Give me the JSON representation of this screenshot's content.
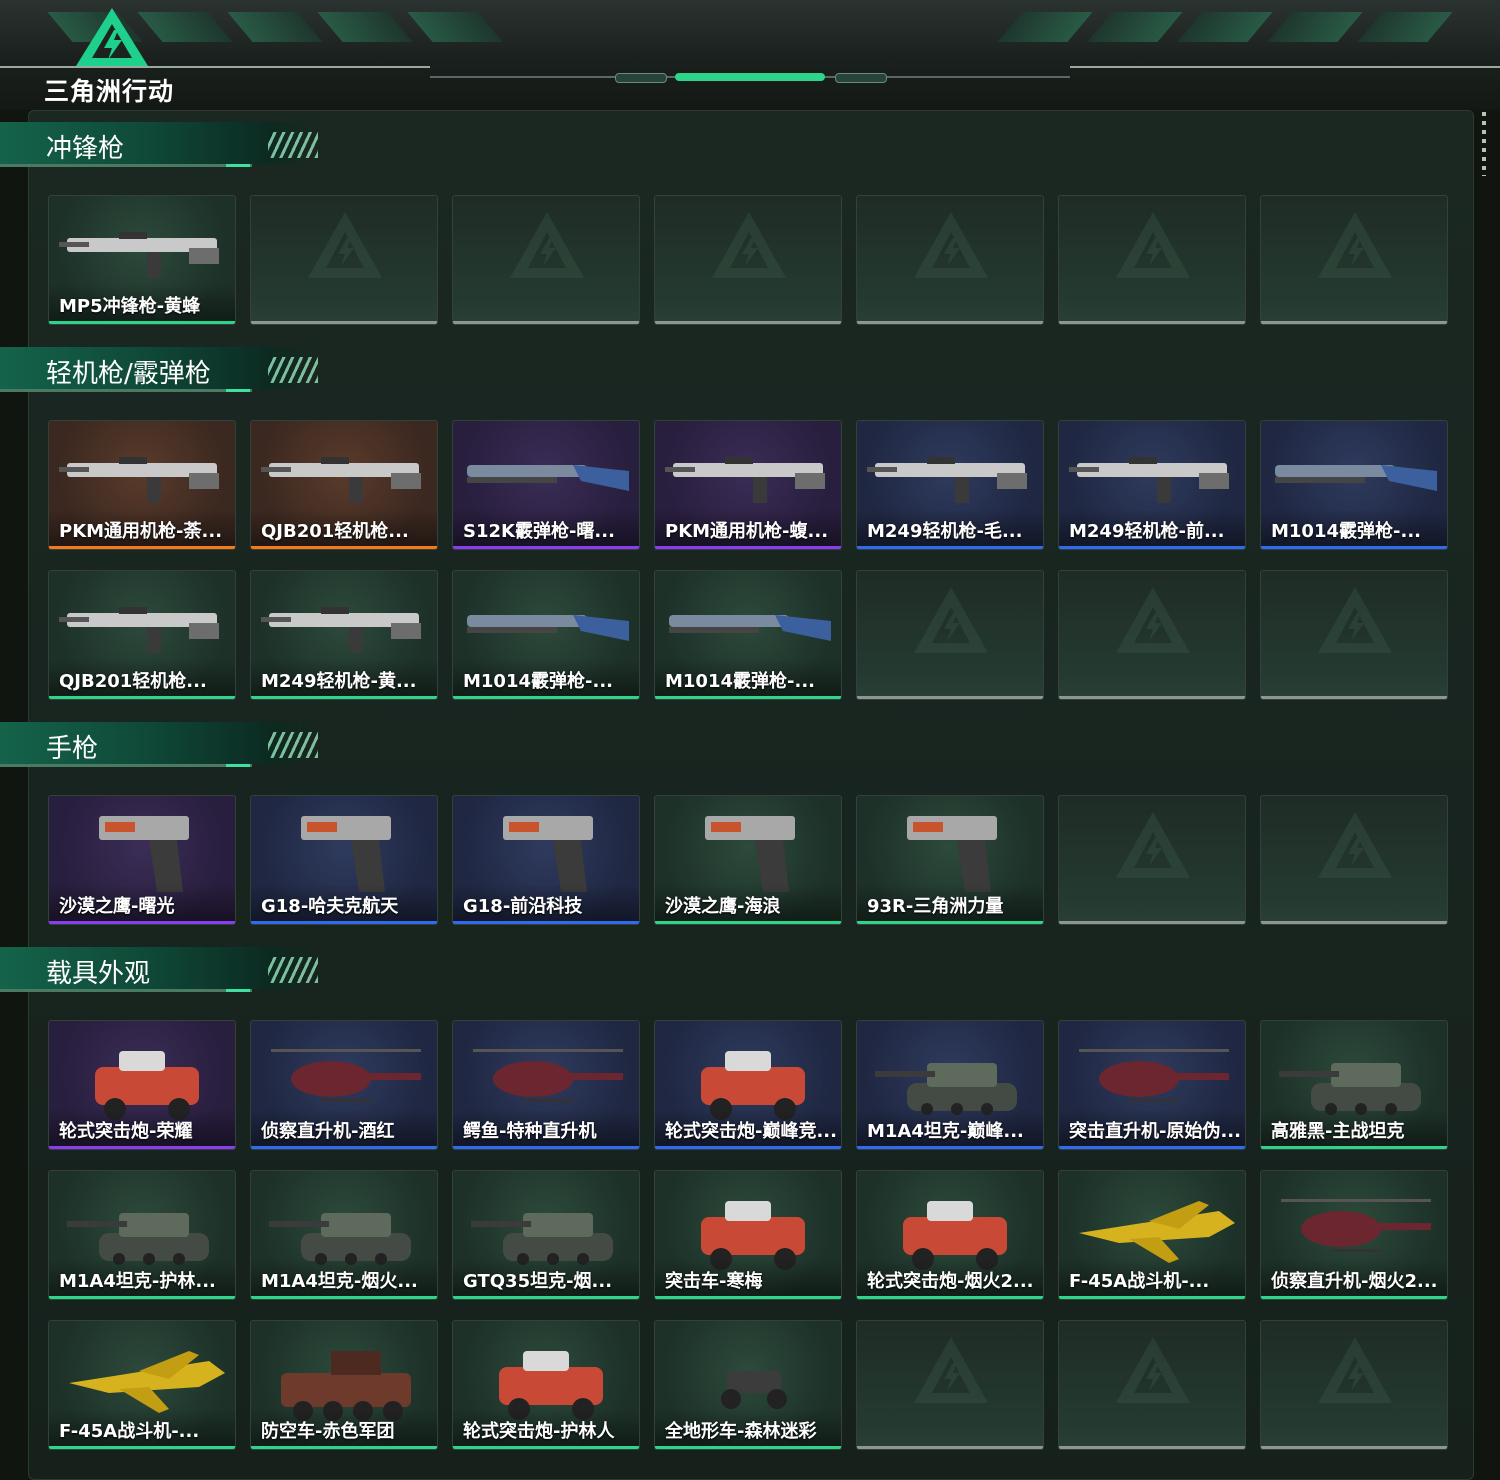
{
  "app": {
    "logo_text": "三角洲行动"
  },
  "colors": {
    "rarity_orange": "#f07a1c",
    "rarity_purple": "#8a3cf0",
    "rarity_blue": "#2f6af0",
    "rarity_green": "#2ed48a",
    "accent": "#3fe0a0"
  },
  "sections": [
    {
      "title": "冲锋枪",
      "items": [
        {
          "label": "MP5冲锋枪-黄蜂",
          "rarity": "green",
          "icon": "smg-icon"
        }
      ]
    },
    {
      "title": "轻机枪/霰弹枪",
      "items": [
        {
          "label": "PKM通用机枪-荼...",
          "rarity": "orange",
          "icon": "machine-gun-icon"
        },
        {
          "label": "QJB201轻机枪...",
          "rarity": "orange",
          "icon": "machine-gun-icon"
        },
        {
          "label": "S12K霰弹枪-曙...",
          "rarity": "purple",
          "icon": "shotgun-icon"
        },
        {
          "label": "PKM通用机枪-蝮...",
          "rarity": "purple",
          "icon": "machine-gun-icon"
        },
        {
          "label": "M249轻机枪-毛...",
          "rarity": "blue",
          "icon": "machine-gun-icon"
        },
        {
          "label": "M249轻机枪-前...",
          "rarity": "blue",
          "icon": "machine-gun-icon"
        },
        {
          "label": "M1014霰弹枪-...",
          "rarity": "blue",
          "icon": "shotgun-icon"
        },
        {
          "label": "QJB201轻机枪...",
          "rarity": "green",
          "icon": "machine-gun-icon"
        },
        {
          "label": "M249轻机枪-黄...",
          "rarity": "green",
          "icon": "machine-gun-icon"
        },
        {
          "label": "M1014霰弹枪-...",
          "rarity": "green",
          "icon": "shotgun-icon"
        },
        {
          "label": "M1014霰弹枪-...",
          "rarity": "green",
          "icon": "shotgun-icon"
        }
      ]
    },
    {
      "title": "手枪",
      "items": [
        {
          "label": "沙漠之鹰-曙光",
          "rarity": "purple",
          "icon": "pistol-icon"
        },
        {
          "label": "G18-哈夫克航天",
          "rarity": "blue",
          "icon": "pistol-icon"
        },
        {
          "label": "G18-前沿科技",
          "rarity": "blue",
          "icon": "pistol-icon"
        },
        {
          "label": "沙漠之鹰-海浪",
          "rarity": "green",
          "icon": "pistol-icon"
        },
        {
          "label": "93R-三角洲力量",
          "rarity": "green",
          "icon": "pistol-icon"
        }
      ]
    },
    {
      "title": "载具外观",
      "items": [
        {
          "label": "轮式突击炮-荣耀",
          "rarity": "purple",
          "icon": "armored-car-icon"
        },
        {
          "label": "侦察直升机-酒红",
          "rarity": "blue",
          "icon": "helicopter-icon"
        },
        {
          "label": "鳄鱼-特种直升机",
          "rarity": "blue",
          "icon": "helicopter-icon"
        },
        {
          "label": "轮式突击炮-巅峰竞...",
          "rarity": "blue",
          "icon": "armored-car-icon"
        },
        {
          "label": "M1A4坦克-巅峰...",
          "rarity": "blue",
          "icon": "tank-icon"
        },
        {
          "label": "突击直升机-原始伪...",
          "rarity": "blue",
          "icon": "helicopter-icon"
        },
        {
          "label": "高雅黑-主战坦克",
          "rarity": "green",
          "icon": "tank-icon"
        },
        {
          "label": "M1A4坦克-护林...",
          "rarity": "green",
          "icon": "tank-icon"
        },
        {
          "label": "M1A4坦克-烟火...",
          "rarity": "green",
          "icon": "tank-icon"
        },
        {
          "label": "GTQ35坦克-烟...",
          "rarity": "green",
          "icon": "tank-icon"
        },
        {
          "label": "突击车-寒梅",
          "rarity": "green",
          "icon": "armored-car-icon"
        },
        {
          "label": "轮式突击炮-烟火2...",
          "rarity": "green",
          "icon": "armored-car-icon"
        },
        {
          "label": "F-45A战斗机-...",
          "rarity": "green",
          "icon": "fighter-jet-icon"
        },
        {
          "label": "侦察直升机-烟火2...",
          "rarity": "green",
          "icon": "helicopter-icon"
        },
        {
          "label": "F-45A战斗机-...",
          "rarity": "green",
          "icon": "fighter-jet-icon"
        },
        {
          "label": "防空车-赤色军团",
          "rarity": "green",
          "icon": "aa-vehicle-icon"
        },
        {
          "label": "轮式突击炮-护林人",
          "rarity": "green",
          "icon": "armored-car-icon"
        },
        {
          "label": "全地形车-森林迷彩",
          "rarity": "green",
          "icon": "atv-icon"
        }
      ]
    }
  ]
}
